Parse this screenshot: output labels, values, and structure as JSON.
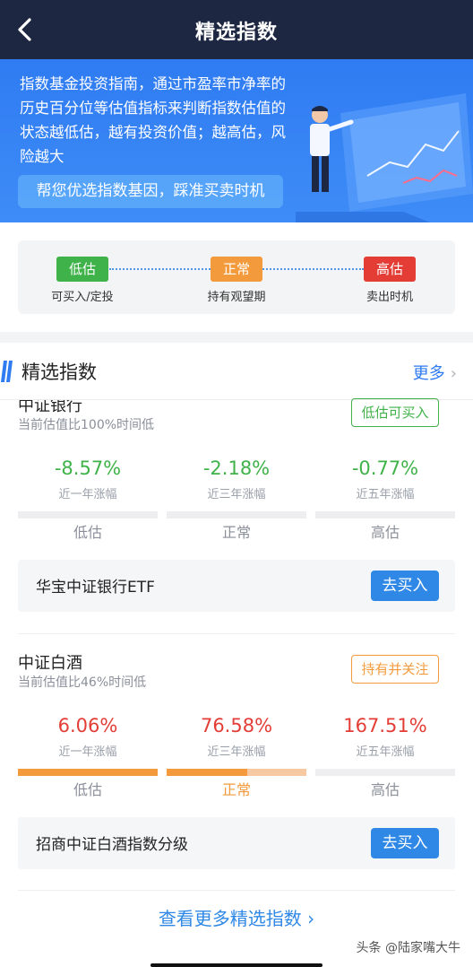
{
  "nav": {
    "title": "精选指数",
    "back_icon": "chevron-left-icon"
  },
  "banner": {
    "text": "指数基金投资指南，通过市盈率市净率的历史百分位等估值指标来判断指数估值的状态越低估，越有投资价值；越高估，风险越大",
    "cta": "帮您优选指数基因，踩准买卖时机"
  },
  "legend": {
    "items": [
      {
        "tag": "低估",
        "desc": "可买入/定投",
        "color": "#3fb249"
      },
      {
        "tag": "正常",
        "desc": "持有观望期",
        "color": "#f39b3c"
      },
      {
        "tag": "高估",
        "desc": "卖出时机",
        "color": "#e33d36"
      }
    ]
  },
  "section": {
    "title": "精选指数",
    "more": "更多"
  },
  "indexes": [
    {
      "name": "中证银行",
      "subtitle": "当前估值比100%时间低",
      "badge": "低估可买入",
      "stats": [
        {
          "value": "-8.57%",
          "label": "近一年涨幅"
        },
        {
          "value": "-2.18%",
          "label": "近三年涨幅"
        },
        {
          "value": "-0.77%",
          "label": "近五年涨幅"
        }
      ],
      "levels": [
        "低估",
        "正常",
        "高估"
      ],
      "fund": {
        "name": "华宝中证银行ETF",
        "button": "去买入"
      }
    },
    {
      "name": "中证白酒",
      "subtitle": "当前估值比46%时间低",
      "badge": "持有并关注",
      "stats": [
        {
          "value": "6.06%",
          "label": "近一年涨幅"
        },
        {
          "value": "76.58%",
          "label": "近三年涨幅"
        },
        {
          "value": "167.51%",
          "label": "近五年涨幅"
        }
      ],
      "levels": [
        "低估",
        "正常",
        "高估"
      ],
      "valuation_position": 0.46,
      "fund": {
        "name": "招商中证白酒指数分级",
        "button": "去买入"
      }
    }
  ],
  "view_more": "查看更多精选指数",
  "watermark": "头条 @陆家嘴大牛",
  "colors": {
    "nav": "#1d2742",
    "primary": "#2f7bf2",
    "green": "#3fb249",
    "orange": "#f39b3c",
    "red": "#e33d36"
  }
}
